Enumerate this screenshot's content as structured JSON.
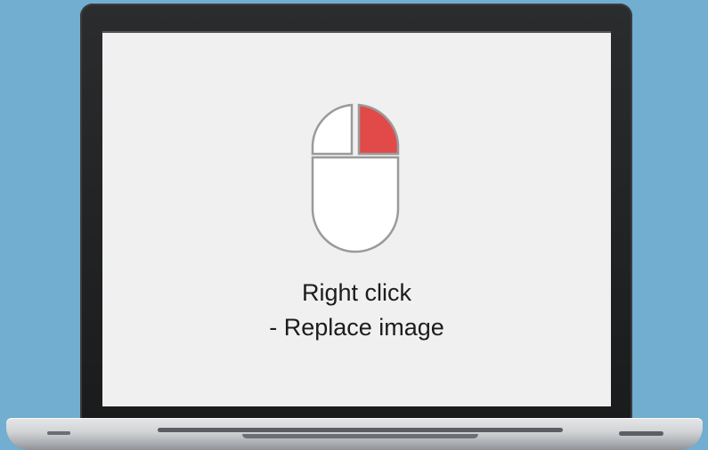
{
  "screen": {
    "caption_line1": "Right click",
    "caption_line2": "- Replace image"
  },
  "mouse": {
    "icon": "mouse-icon",
    "highlighted_button": "right",
    "highlight_color": "#e24a4a"
  },
  "colors": {
    "background": "#71aed0",
    "screen": "#f0f0f0",
    "bezel": "#1f2022"
  }
}
